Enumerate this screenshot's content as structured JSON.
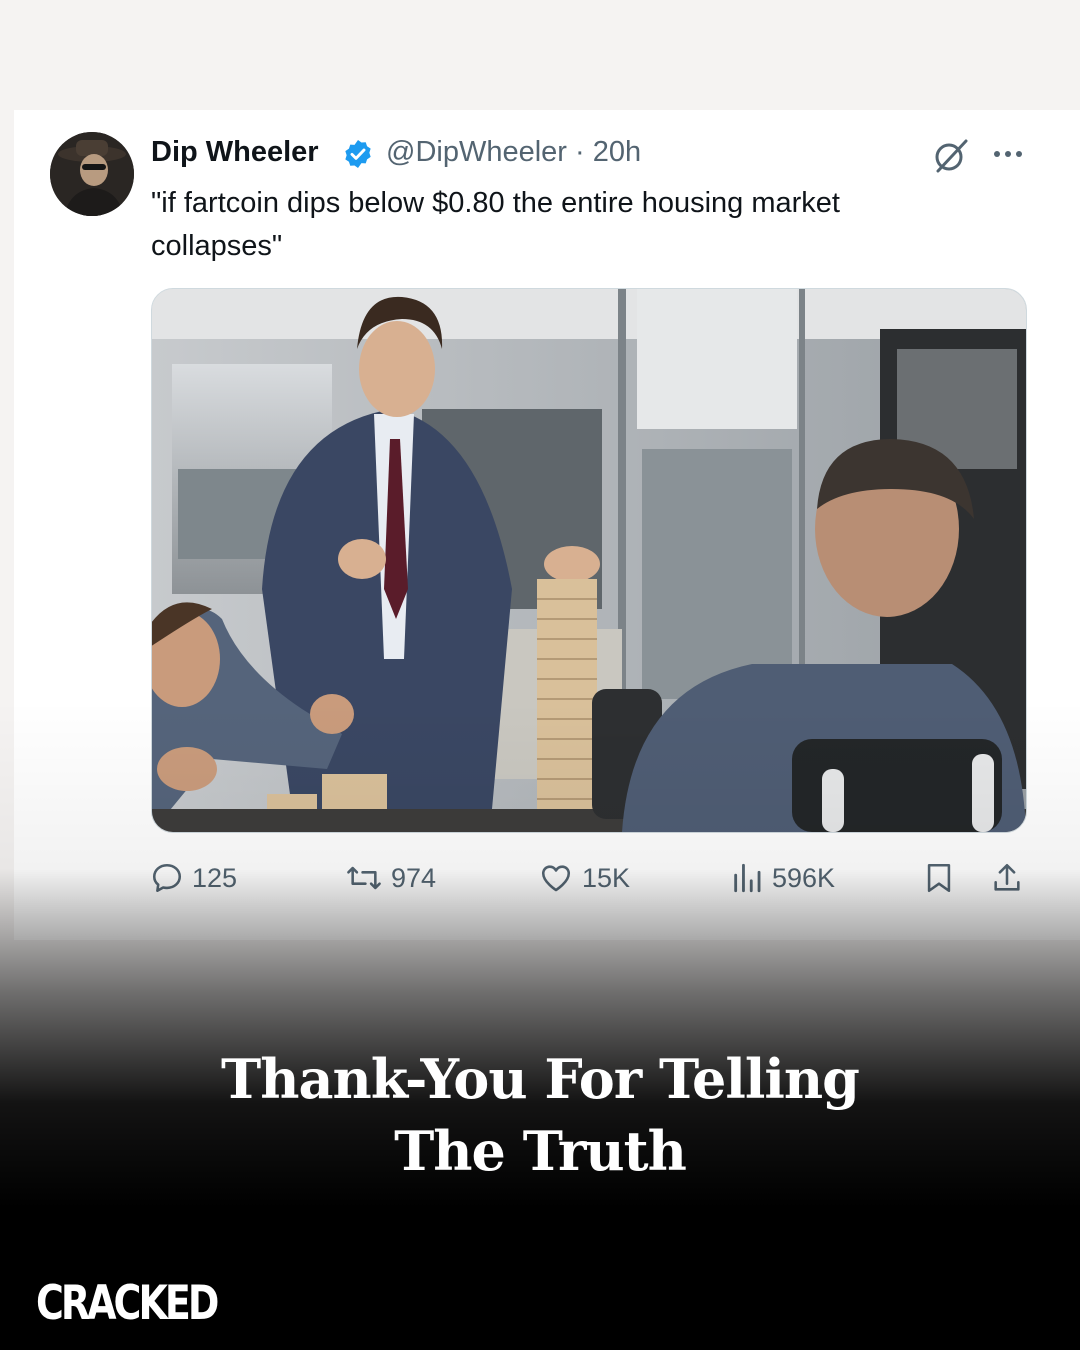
{
  "tweet": {
    "display_name": "Dip Wheeler",
    "handle_time": "@DipWheeler · 20h",
    "text": "\"if fartcoin dips below $0.80 the entire housing market collapses\"",
    "verified_color": "#1d9bf0"
  },
  "actions": {
    "replies": "125",
    "retweets": "974",
    "likes": "15K",
    "views": "596K"
  },
  "overlay": {
    "caption_line1": "Thank-You For Telling",
    "caption_line2": "The Truth",
    "brand": "CRACKED"
  },
  "colors": {
    "text_primary": "#0f1419",
    "text_secondary": "#536471",
    "accent": "#1d9bf0"
  }
}
